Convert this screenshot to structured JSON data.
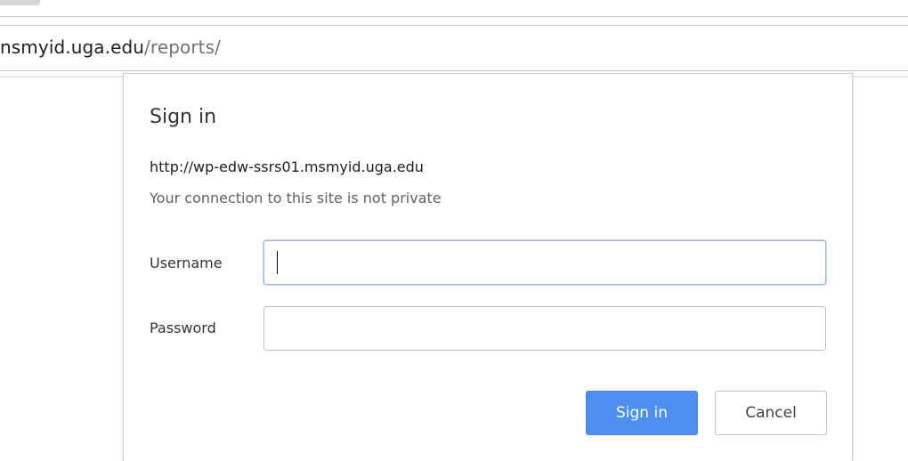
{
  "browser": {
    "address_host": "nsmyid.uga.edu",
    "address_path": "/reports/"
  },
  "dialog": {
    "title": "Sign in",
    "site_url": "http://wp-edw-ssrs01.msmyid.uga.edu",
    "privacy_note": "Your connection to this site is not private",
    "username_label": "Username",
    "username_value": "",
    "password_label": "Password",
    "password_value": "",
    "signin_label": "Sign in",
    "cancel_label": "Cancel"
  },
  "colors": {
    "primary_button": "#4d8ff0",
    "focus_border": "#9fb5dc",
    "muted_text": "#5f6368"
  }
}
